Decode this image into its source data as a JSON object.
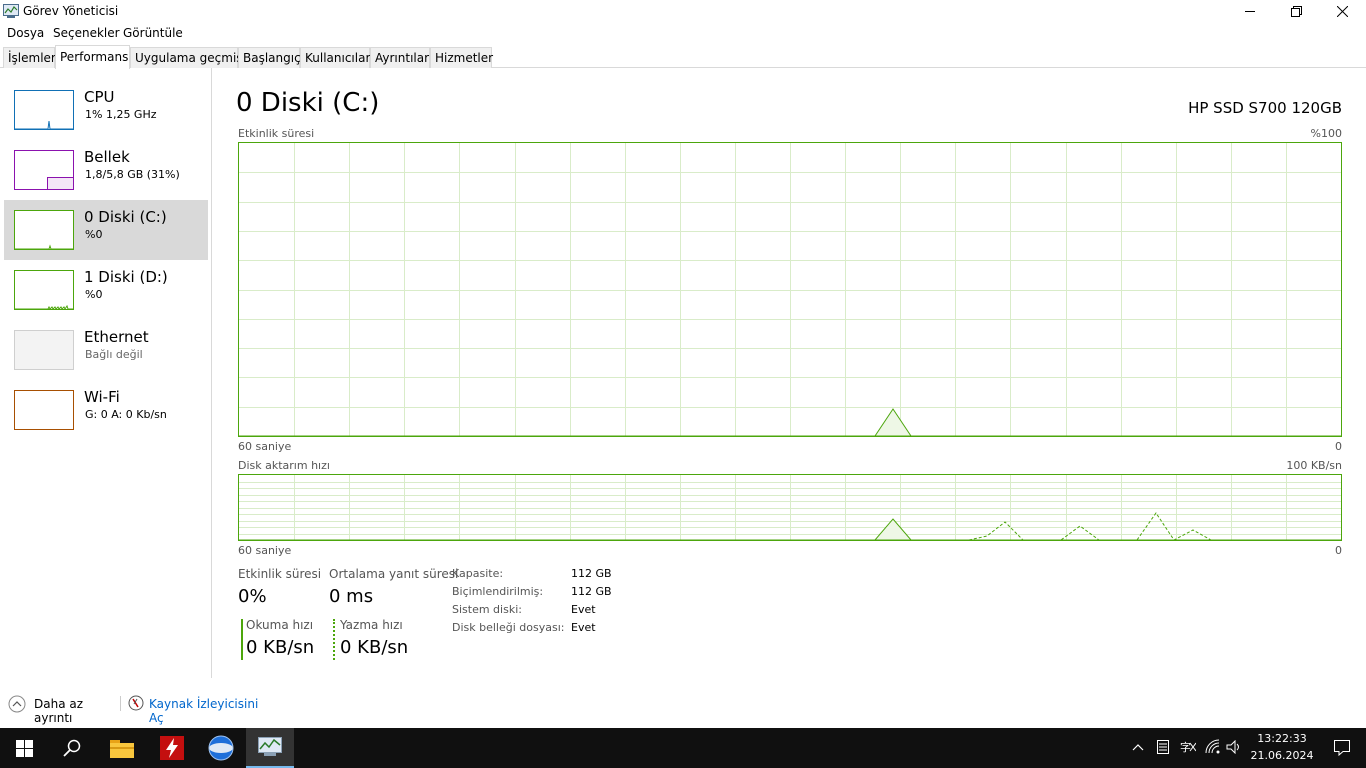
{
  "window": {
    "title": "Görev Yöneticisi"
  },
  "menu": [
    "Dosya",
    "Seçenekler",
    "Görüntüle"
  ],
  "tabs": [
    "İşlemler",
    "Performans",
    "Uygulama geçmişi",
    "Başlangıç",
    "Kullanıcılar",
    "Ayrıntılar",
    "Hizmetler"
  ],
  "active_tab": "Performans",
  "sidebar": {
    "items": [
      {
        "title": "CPU",
        "sub": "1% 1,25 GHz",
        "color": "#1170b5"
      },
      {
        "title": "Bellek",
        "sub": "1,8/5,8 GB (31%)",
        "color": "#8b12ae",
        "level_fraction": 0.31
      },
      {
        "title": "0 Diski (C:)",
        "sub": "%0",
        "color": "#4ca60c",
        "selected": true
      },
      {
        "title": "1 Diski (D:)",
        "sub": "%0",
        "color": "#4ca60c"
      },
      {
        "title": "Ethernet",
        "sub": "Bağlı değil",
        "color": "#a0a0a0"
      },
      {
        "title": "Wi-Fi",
        "sub": "G: 0 A: 0 Kb/sn",
        "color": "#a74f01"
      }
    ]
  },
  "main": {
    "title": "0 Diski (C:)",
    "model": "HP SSD S700 120GB",
    "chart1": {
      "label": "Etkinlik süresi",
      "max_label": "%100",
      "left_bottom": "60 saniye",
      "right_bottom": "0"
    },
    "chart2": {
      "label": "Disk aktarım hızı",
      "max_label": "100 KB/sn",
      "left_bottom": "60 saniye",
      "right_bottom": "0"
    },
    "stats": {
      "activity_label": "Etkinlik süresi",
      "activity_value": "0%",
      "response_label": "Ortalama yanıt süresi",
      "response_value": "0 ms",
      "read_label": "Okuma hızı",
      "read_value": "0 KB/sn",
      "write_label": "Yazma hızı",
      "write_value": "0 KB/sn"
    },
    "info": [
      {
        "key": "Kapasite:",
        "value": "112 GB"
      },
      {
        "key": "Biçimlendirilmiş:",
        "value": "112 GB"
      },
      {
        "key": "Sistem diski:",
        "value": "Evet"
      },
      {
        "key": "Disk belleği dosyası:",
        "value": "Evet"
      }
    ]
  },
  "footer": {
    "less_details": "Daha az ayrıntı",
    "resource_monitor": "Kaynak İzleyicisini Aç"
  },
  "taskbar": {
    "time": "13:22:33",
    "date": "21.06.2024"
  },
  "colors": {
    "disk": "#4ca60c",
    "cpu": "#1170b5",
    "memory": "#8b12ae",
    "wifi": "#a74f01",
    "link": "#0066cc",
    "taskbar": "#101010"
  }
}
